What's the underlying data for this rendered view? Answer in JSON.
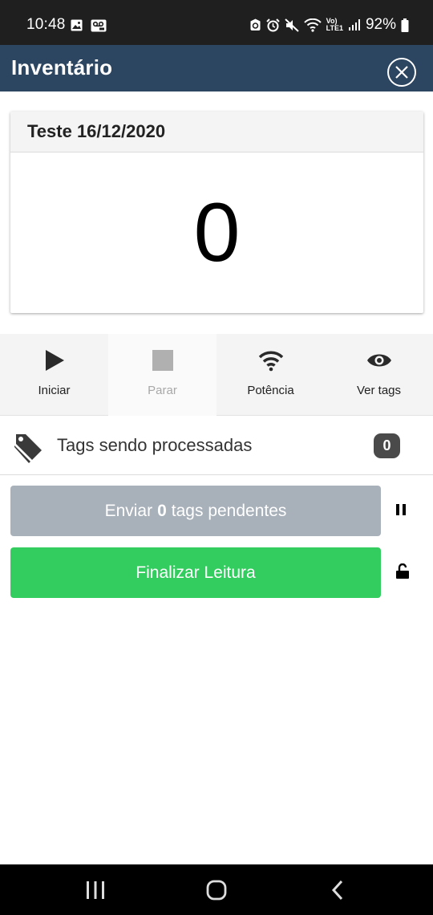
{
  "status_bar": {
    "time": "10:48",
    "battery_percent": "92%",
    "network_label_top": "Vo)",
    "network_label_bottom": "LTE1",
    "icons": [
      "gallery-icon",
      "voicemail-icon",
      "bixby-icon",
      "alarm-icon",
      "mute-icon",
      "wifi-icon",
      "signal-icon",
      "battery-icon"
    ]
  },
  "header": {
    "title": "Inventário",
    "close_icon": "close-circle-icon",
    "background_color": "#2c4560"
  },
  "inventory_card": {
    "title": "Teste 16/12/2020",
    "count": "0"
  },
  "toolbar": {
    "items": [
      {
        "label": "Iniciar",
        "icon": "play-icon",
        "enabled": true
      },
      {
        "label": "Parar",
        "icon": "stop-icon",
        "enabled": false
      },
      {
        "label": "Potência",
        "icon": "wifi-icon",
        "enabled": true
      },
      {
        "label": "Ver tags",
        "icon": "eye-icon",
        "enabled": true
      }
    ]
  },
  "processing": {
    "label": "Tags sendo processadas",
    "count": "0",
    "icon": "tags-icon"
  },
  "send_button": {
    "prefix": "Enviar",
    "count": "0",
    "suffix": "tags pendentes",
    "color": "#a8b0b9",
    "side_icon": "pause-icon"
  },
  "finish_button": {
    "label": "Finalizar Leitura",
    "color": "#33cc5f",
    "side_icon": "unlock-icon"
  },
  "nav_bar": {
    "buttons": [
      "recent-apps-icon",
      "home-icon",
      "back-icon"
    ]
  }
}
